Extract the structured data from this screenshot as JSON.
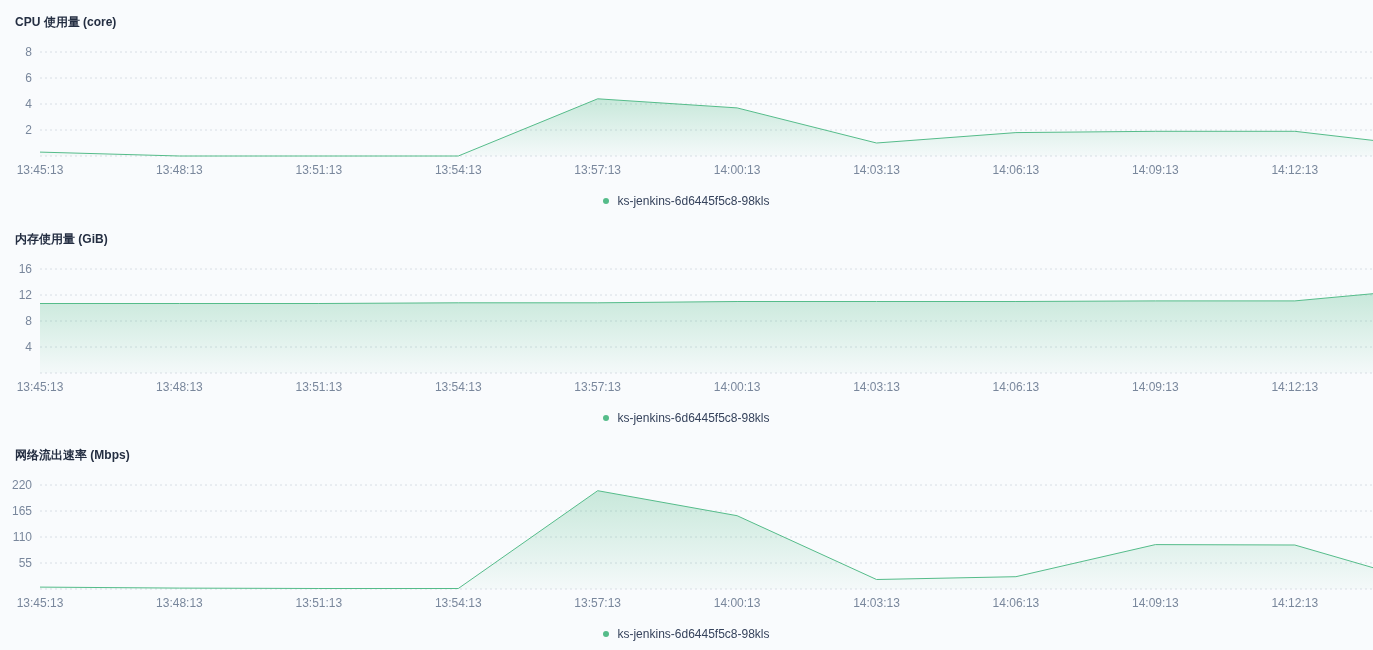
{
  "panels": [
    {
      "chart_data": {
        "type": "area",
        "title": "CPU 使用量 (core)",
        "x": [
          49513,
          49693,
          49873,
          50053,
          50233,
          50413,
          50593,
          50773,
          50953,
          51133,
          51234
        ],
        "xlim": [
          49513,
          51234
        ],
        "ylim": [
          0,
          8
        ],
        "grid": true,
        "yticks": [
          2,
          4,
          6,
          8
        ],
        "xticks": [
          {
            "value": 49513,
            "label": "13:45:13"
          },
          {
            "value": 49693,
            "label": "13:48:13"
          },
          {
            "value": 49873,
            "label": "13:51:13"
          },
          {
            "value": 50053,
            "label": "13:54:13"
          },
          {
            "value": 50233,
            "label": "13:57:13"
          },
          {
            "value": 50413,
            "label": "14:00:13"
          },
          {
            "value": 50593,
            "label": "14:03:13"
          },
          {
            "value": 50773,
            "label": "14:06:13"
          },
          {
            "value": 50953,
            "label": "14:09:13"
          },
          {
            "value": 51133,
            "label": "14:12:13"
          }
        ],
        "series": [
          {
            "name": "ks-jenkins-6d6445f5c8-98kls",
            "color": "#55bc8a",
            "values": [
              0.3,
              0,
              0,
              0,
              4.4,
              3.7,
              1,
              1.8,
              1.9,
              1.9,
              1.2
            ]
          }
        ]
      }
    },
    {
      "chart_data": {
        "type": "area",
        "title": "内存使用量 (GiB)",
        "x": [
          49513,
          49693,
          49873,
          50053,
          50233,
          50413,
          50593,
          50773,
          50953,
          51133,
          51234
        ],
        "xlim": [
          49513,
          51234
        ],
        "ylim": [
          0,
          16
        ],
        "grid": true,
        "yticks": [
          4,
          8,
          12,
          16
        ],
        "xticks": [
          {
            "value": 49513,
            "label": "13:45:13"
          },
          {
            "value": 49693,
            "label": "13:48:13"
          },
          {
            "value": 49873,
            "label": "13:51:13"
          },
          {
            "value": 50053,
            "label": "13:54:13"
          },
          {
            "value": 50233,
            "label": "13:57:13"
          },
          {
            "value": 50413,
            "label": "14:00:13"
          },
          {
            "value": 50593,
            "label": "14:03:13"
          },
          {
            "value": 50773,
            "label": "14:06:13"
          },
          {
            "value": 50953,
            "label": "14:09:13"
          },
          {
            "value": 51133,
            "label": "14:12:13"
          }
        ],
        "series": [
          {
            "name": "ks-jenkins-6d6445f5c8-98kls",
            "color": "#55bc8a",
            "values": [
              10.7,
              10.7,
              10.7,
              10.8,
              10.8,
              11,
              11,
              11,
              11.1,
              11.1,
              12.2
            ]
          }
        ]
      }
    },
    {
      "chart_data": {
        "type": "area",
        "title": "网络流出速率 (Mbps)",
        "x": [
          49513,
          49693,
          49873,
          50053,
          50233,
          50413,
          50593,
          50773,
          50953,
          51133,
          51234
        ],
        "xlim": [
          49513,
          51234
        ],
        "ylim": [
          0,
          220
        ],
        "grid": true,
        "yticks": [
          55,
          110,
          165,
          220
        ],
        "xticks": [
          {
            "value": 49513,
            "label": "13:45:13"
          },
          {
            "value": 49693,
            "label": "13:48:13"
          },
          {
            "value": 49873,
            "label": "13:51:13"
          },
          {
            "value": 50053,
            "label": "13:54:13"
          },
          {
            "value": 50233,
            "label": "13:57:13"
          },
          {
            "value": 50413,
            "label": "14:00:13"
          },
          {
            "value": 50593,
            "label": "14:03:13"
          },
          {
            "value": 50773,
            "label": "14:06:13"
          },
          {
            "value": 50953,
            "label": "14:09:13"
          },
          {
            "value": 51133,
            "label": "14:12:13"
          }
        ],
        "series": [
          {
            "name": "ks-jenkins-6d6445f5c8-98kls",
            "color": "#55bc8a",
            "values": [
              4,
              2,
              1,
              1,
              208,
              155,
              20,
              26,
              94,
              93,
              45
            ]
          }
        ]
      }
    }
  ]
}
